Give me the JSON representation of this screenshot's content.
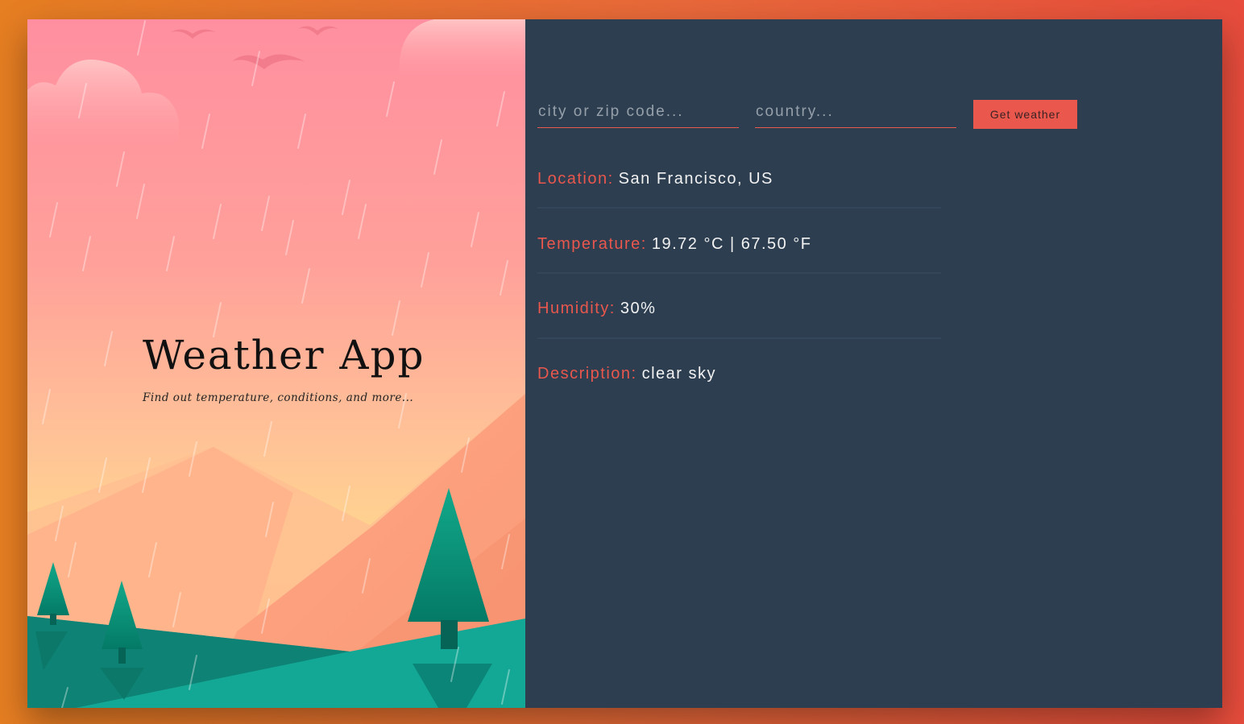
{
  "hero": {
    "title": "Weather App",
    "subtitle": "Find out temperature, conditions, and more..."
  },
  "form": {
    "city_placeholder": "city or zip code...",
    "city_value": "",
    "country_placeholder": "country...",
    "country_value": "",
    "submit_label": "Get weather"
  },
  "results": [
    {
      "label": "Location:",
      "value": "San Francisco, US"
    },
    {
      "label": "Temperature:",
      "value": "19.72 °C | 67.50 °F"
    },
    {
      "label": "Humidity:",
      "value": "30%"
    },
    {
      "label": "Description:",
      "value": "clear sky"
    }
  ],
  "colors": {
    "accent": "#e9574d",
    "panel_bg": "#2c3e50",
    "page_gradient_start": "#e67e22",
    "page_gradient_end": "#e74c3c"
  }
}
